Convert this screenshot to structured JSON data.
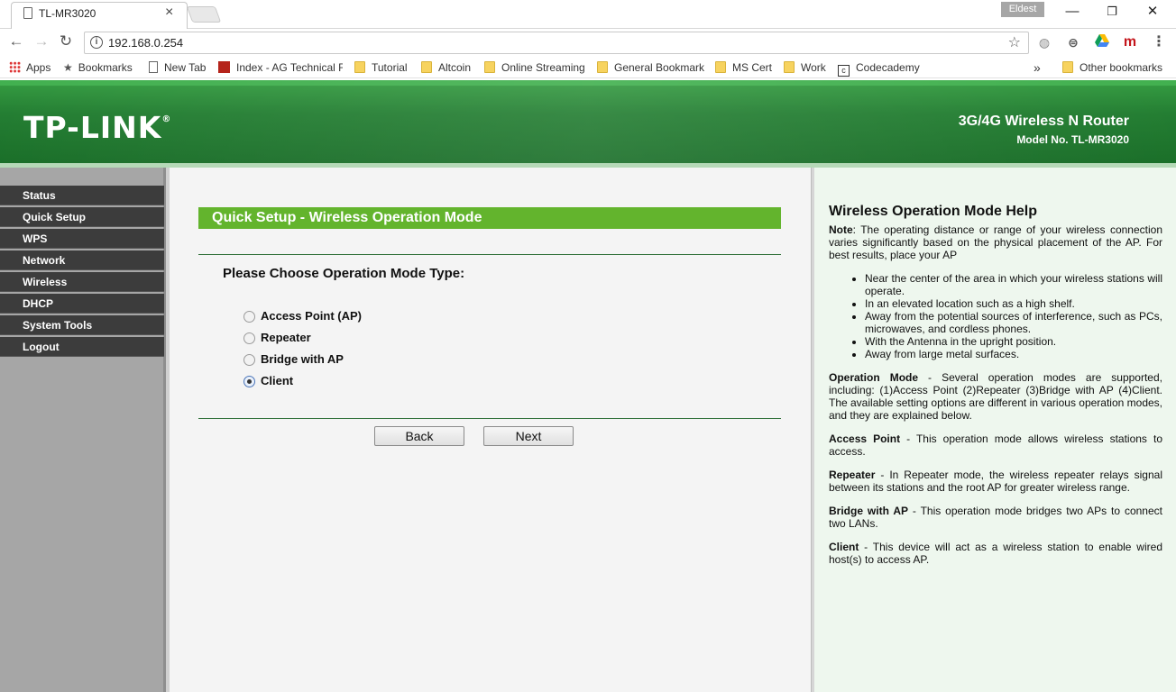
{
  "browser": {
    "tab_title": "TL-MR3020",
    "tab_close": "×",
    "profile_name": "Eldest",
    "window_min": "—",
    "window_max": "❐",
    "window_close": "✕",
    "url": "192.168.0.254",
    "info_glyph": "i",
    "star_glyph": "☆",
    "back_glyph": "←",
    "forward_glyph": "→",
    "reload_glyph": "↻",
    "menu_glyph": "⋮",
    "ext_m": "m"
  },
  "bookmarks": {
    "items": [
      {
        "label": "Apps",
        "icon": "apps-grid-icon"
      },
      {
        "label": "Bookmarks",
        "icon": "star-icon"
      },
      {
        "label": "New Tab",
        "icon": "page-icon"
      },
      {
        "label": "Index - AG Technical F",
        "icon": "site-icon"
      },
      {
        "label": "Tutorial",
        "icon": "folder-icon"
      },
      {
        "label": "Altcoin",
        "icon": "folder-icon"
      },
      {
        "label": "Online Streaming",
        "icon": "folder-icon"
      },
      {
        "label": "General Bookmark",
        "icon": "folder-icon"
      },
      {
        "label": "MS Cert",
        "icon": "folder-icon"
      },
      {
        "label": "Work",
        "icon": "folder-icon"
      },
      {
        "label": "Codecademy",
        "icon": "codecademy-icon"
      }
    ],
    "overflow": "»",
    "other": "Other bookmarks",
    "star_glyph": "★",
    "cc_glyph": "c"
  },
  "router": {
    "logo": "TP-LINK",
    "logo_mark": "®",
    "product_name": "3G/4G Wireless N Router",
    "model": "Model No. TL-MR3020"
  },
  "menu": [
    "Status",
    "Quick Setup",
    "WPS",
    "Network",
    "Wireless",
    "DHCP",
    "System Tools",
    "Logout"
  ],
  "main": {
    "title": "Quick Setup - Wireless Operation Mode",
    "prompt": "Please Choose Operation Mode Type:",
    "options": [
      {
        "label": "Access Point (AP)",
        "checked": false
      },
      {
        "label": "Repeater",
        "checked": false
      },
      {
        "label": "Bridge with AP",
        "checked": false
      },
      {
        "label": "Client",
        "checked": true
      }
    ],
    "back_label": "Back",
    "next_label": "Next"
  },
  "help": {
    "title": "Wireless Operation Mode Help",
    "note_label": "Note",
    "note_text": ": The operating distance or range of your wireless connection varies significantly based on the physical placement of the AP. For best results, place your AP",
    "bullets": [
      "Near the center of the area in which your wireless stations will operate.",
      "In an elevated location such as a high shelf.",
      "Away from the potential sources of interference, such as PCs, microwaves, and cordless phones.",
      "With the Antenna in the upright position.",
      "Away from large metal surfaces."
    ],
    "op_mode_label": "Operation Mode",
    "op_mode_text": " - Several operation modes are supported, including: (1)Access Point (2)Repeater (3)Bridge with AP (4)Client. The available setting options are different in various operation modes, and they are explained below.",
    "ap_label": "Access Point",
    "ap_text": " - This operation mode allows wireless stations to access.",
    "repeater_label": "Repeater",
    "repeater_text": " - In Repeater mode, the wireless repeater relays signal between its stations and the root AP for greater wireless range.",
    "bridge_label": "Bridge with AP",
    "bridge_text": " - This operation mode bridges two APs to connect two LANs.",
    "client_label": "Client",
    "client_text": " - This device will act as a wireless station to enable wired host(s) to access AP."
  }
}
